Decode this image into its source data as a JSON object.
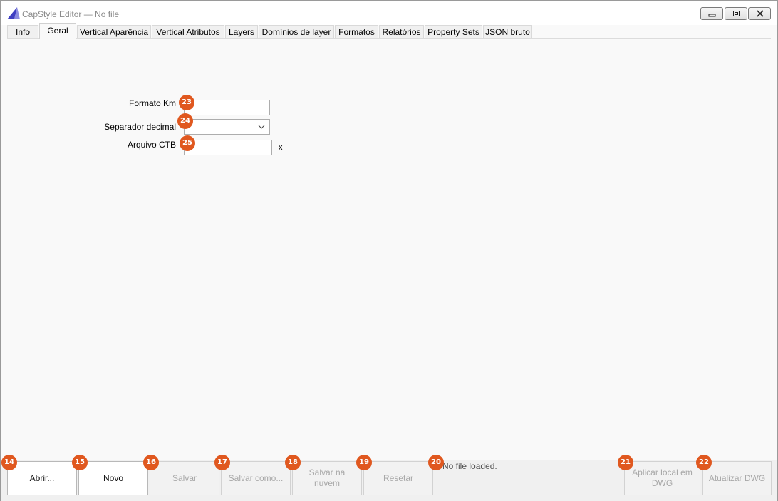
{
  "window": {
    "title": "CapStyle Editor — No file",
    "accent": "#3f3fc2"
  },
  "tabs": [
    {
      "label": "Info"
    },
    {
      "label": "Geral",
      "active": true
    },
    {
      "label": "Vertical Aparência"
    },
    {
      "label": "Vertical Atributos"
    },
    {
      "label": "Layers"
    },
    {
      "label": "Domínios de layer"
    },
    {
      "label": "Formatos"
    },
    {
      "label": "Relatórios"
    },
    {
      "label": "Property Sets"
    },
    {
      "label": "JSON bruto"
    }
  ],
  "form": {
    "formato_km_label": "Formato Km",
    "formato_km_value": "",
    "separador_label": "Separador decimal",
    "separador_value": "",
    "arquivo_ctb_label": "Arquivo CTB",
    "arquivo_ctb_value": "",
    "clear_label": "x"
  },
  "buttons": {
    "open": "Abrir...",
    "new": "Novo",
    "save": "Salvar",
    "save_as": "Salvar como...",
    "save_cloud": "Salvar na nuvem",
    "reset": "Resetar",
    "apply_local": "Aplicar local em DWG",
    "update_dwg": "Atualizar DWG"
  },
  "status": {
    "text": "No file loaded."
  },
  "badges": {
    "b14": "14",
    "b15": "15",
    "b16": "16",
    "b17": "17",
    "b18": "18",
    "b19": "19",
    "b20": "20",
    "b21": "21",
    "b22": "22",
    "b23": "23",
    "b24": "24",
    "b25": "25"
  },
  "colors": {
    "badge": "#e0581f"
  }
}
